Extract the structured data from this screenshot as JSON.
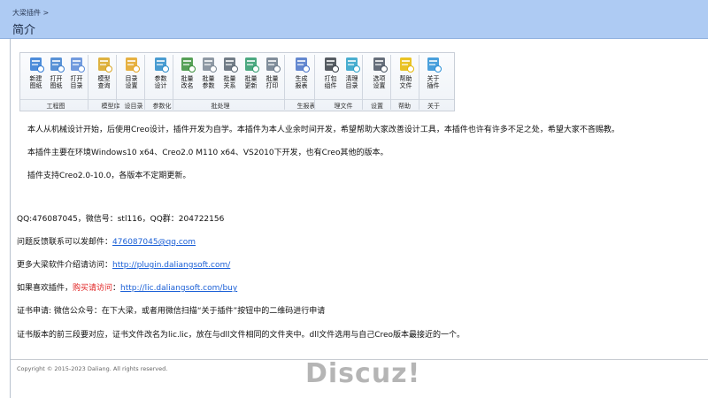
{
  "header": {
    "breadcrumb": "大梁插件 >",
    "title": "简介"
  },
  "ribbon": {
    "buttons": [
      {
        "id": "new-drawing",
        "label": "新建\n图纸",
        "icon": "new-drawing-icon",
        "color": "#2f79d4"
      },
      {
        "id": "open-drawing",
        "label": "打开\n图纸",
        "icon": "open-drawing-icon",
        "color": "#3d7fcf"
      },
      {
        "id": "open-dir",
        "label": "打开\n目录",
        "icon": "open-directory-icon",
        "color": "#5a8ad8"
      },
      {
        "id": "model-query",
        "label": "模型\n查询",
        "icon": "model-query-icon",
        "color": "#d9a420"
      },
      {
        "id": "dir-settings",
        "label": "目录\n设置",
        "icon": "folder-settings-icon",
        "color": "#e3a321"
      },
      {
        "id": "param-design",
        "label": "参数\n设计",
        "icon": "parameter-design-icon",
        "color": "#2a8bc9"
      },
      {
        "id": "batch-rename",
        "label": "批量\n改名",
        "icon": "batch-rename-icon",
        "color": "#3a8f3a"
      },
      {
        "id": "batch-params",
        "label": "批量\n参数",
        "icon": "batch-parameters-icon",
        "color": "#7b8794"
      },
      {
        "id": "batch-relations",
        "label": "批量\n关系",
        "icon": "batch-relations-icon",
        "color": "#5b6672"
      },
      {
        "id": "batch-update",
        "label": "批量\n更新",
        "icon": "batch-update-icon",
        "color": "#2e9a6b"
      },
      {
        "id": "batch-print",
        "label": "批量\n打印",
        "icon": "batch-print-icon",
        "color": "#6c7a8a"
      },
      {
        "id": "gen-report",
        "label": "生成\n报表",
        "icon": "generate-report-icon",
        "color": "#4a73c8"
      },
      {
        "id": "pack-assembly",
        "label": "打包\n组件",
        "icon": "pack-assembly-icon",
        "color": "#3a3f47"
      },
      {
        "id": "clean-dir",
        "label": "清理\n目录",
        "icon": "clean-directory-icon",
        "color": "#2aa0c8"
      },
      {
        "id": "options",
        "label": "选项\n设置",
        "icon": "options-gear-icon",
        "color": "#4b5563"
      },
      {
        "id": "help-file",
        "label": "帮助\n文件",
        "icon": "help-file-icon",
        "color": "#e6b800"
      },
      {
        "id": "about",
        "label": "关于\n插件",
        "icon": "about-info-icon",
        "color": "#2b8fd6"
      }
    ],
    "groups": [
      {
        "label": "工程图"
      },
      {
        "label": "模型库"
      },
      {
        "label": "设目录"
      },
      {
        "label": "参数化"
      },
      {
        "label": "批处理"
      },
      {
        "label": "生报表"
      },
      {
        "label": "理文件"
      },
      {
        "label": "设置"
      },
      {
        "label": "帮助"
      },
      {
        "label": "关于"
      }
    ]
  },
  "intro": {
    "line1": "本人从机械设计开始，后使用Creo设计，插件开发为自学。本插件为本人业余时间开发，希望帮助大家改善设计工具，本插件也许有许多不足之处，希望大家不吝赐教。",
    "line2": "本插件主要在环境Windows10 x64、Creo2.0 M110 x64、VS2010下开发，也有Creo其他的版本。",
    "line3": "插件支持Creo2.0-10.0，各版本不定期更新。"
  },
  "info": {
    "contact": "QQ:476087045，微信号：stl116，QQ群：204722156",
    "feedback_prefix": "问题反馈联系可以发邮件：",
    "feedback_email": "476087045@qq.com",
    "intro_prefix": "更多大梁软件介绍请访问：",
    "intro_url": "http://plugin.daliangsoft.com/",
    "buy_prefix": "如果喜欢插件，",
    "buy_red": "购买请访问",
    "buy_colon": "：",
    "buy_url": "http://lic.daliangsoft.com/buy",
    "cert_apply": "证书申请: 微信公众号：在下大梁，或者用微信扫描“关于插件”按钮中的二维码进行申请",
    "cert_version": "证书版本的前三段要对应，证书文件改名为lic.lic，放在与dll文件相同的文件夹中。dll文件选用与自己Creo版本最接近的一个。"
  },
  "footer": {
    "copyright": "Copyright © 2015-2023 Daliang. All rights reserved."
  },
  "watermark": "Discuz!"
}
